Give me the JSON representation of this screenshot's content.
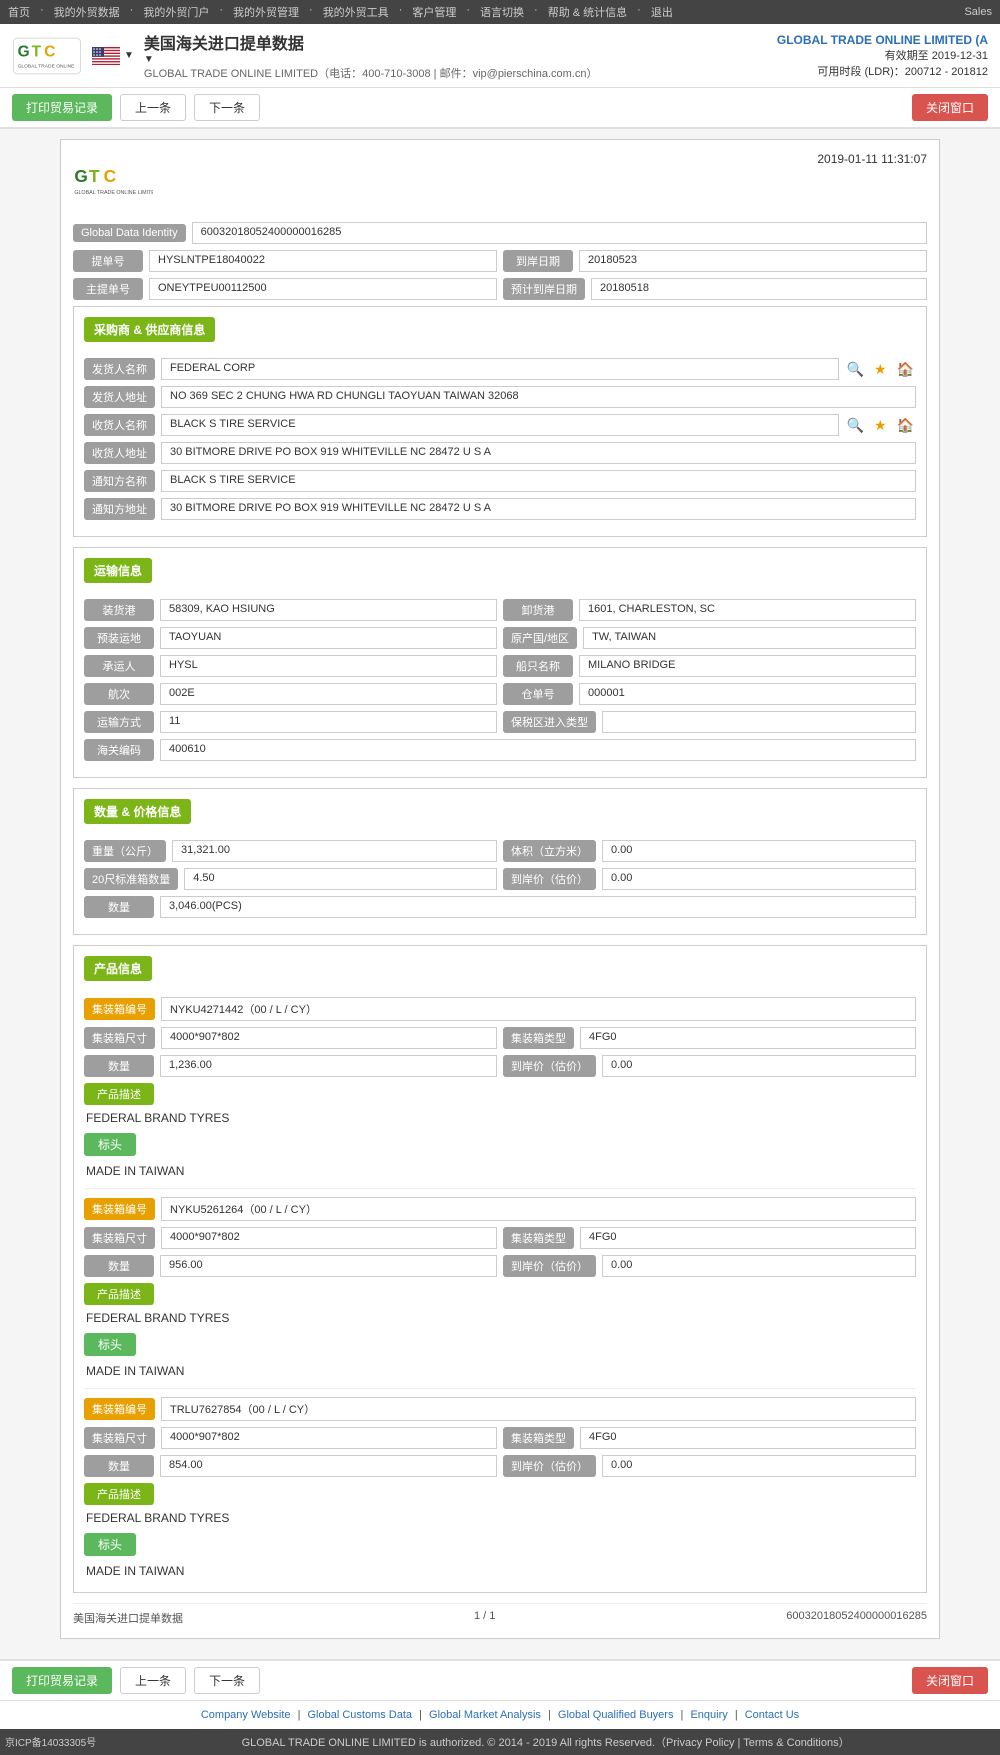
{
  "topnav": {
    "items": [
      "首页",
      "我的外贸数据",
      "我的外贸门户",
      "我的外贸管理",
      "我的外贸工具",
      "客户管理",
      "语言切换",
      "帮助 & 统计信息",
      "退出"
    ],
    "sales": "Sales"
  },
  "header": {
    "page_title": "美国海关进口提单数据",
    "subtitle": "GLOBAL TRADE ONLINE LIMITED（电话：400-710-3008 | 邮件：vip@pierschina.com.cn）",
    "brand": "GLOBAL TRADE ONLINE LIMITED (A",
    "valid_until": "有效期至 2019-12-31",
    "ldr": "可用时段 (LDR)：200712 - 201812"
  },
  "toolbar": {
    "print_label": "打印贸易记录",
    "prev_label": "上一条",
    "next_label": "下一条",
    "close_label": "关闭窗口"
  },
  "document": {
    "timestamp": "2019-01-11 11:31:07",
    "gdi_label": "Global Data Identity",
    "gdi_value": "60032018052400000016285",
    "fields": {
      "提单号_label": "提单号",
      "提单号_value": "HYSLNTPE18040022",
      "到岸日期_label": "到岸日期",
      "到岸日期_value": "20180523",
      "主提单号_label": "主提单号",
      "主提单号_value": "ONEYTPEU00112500",
      "预计到岸日期_label": "预计到岸日期",
      "预计到岸日期_value": "20180518"
    }
  },
  "buyer_supplier": {
    "section_title": "采购商 & 供应商信息",
    "rows": [
      {
        "label": "发货人名称",
        "value": "FEDERAL CORP",
        "has_icons": true
      },
      {
        "label": "发货人地址",
        "value": "NO 369 SEC 2 CHUNG HWA RD CHUNGLI TAOYUAN TAIWAN 32068",
        "has_icons": false
      },
      {
        "label": "收货人名称",
        "value": "BLACK S TIRE SERVICE",
        "has_icons": true
      },
      {
        "label": "收货人地址",
        "value": "30 BITMORE DRIVE PO BOX 919 WHITEVILLE NC 28472 U S A",
        "has_icons": false
      },
      {
        "label": "通知方名称",
        "value": "BLACK S TIRE SERVICE",
        "has_icons": false
      },
      {
        "label": "通知方地址",
        "value": "30 BITMORE DRIVE PO BOX 919 WHITEVILLE NC 28472 U S A",
        "has_icons": false
      }
    ]
  },
  "transport": {
    "section_title": "运输信息",
    "rows": [
      {
        "label1": "装货港",
        "value1": "58309, KAO HSIUNG",
        "label2": "卸货港",
        "value2": "1601, CHARLESTON, SC"
      },
      {
        "label1": "预装运地",
        "value1": "TAOYUAN",
        "label2": "原产国/地区",
        "value2": "TW, TAIWAN"
      },
      {
        "label1": "承运人",
        "value1": "HYSL",
        "label2": "船只名称",
        "value2": "MILANO BRIDGE"
      },
      {
        "label1": "航次",
        "value1": "002E",
        "label2": "仓单号",
        "value2": "000001"
      },
      {
        "label1": "运输方式",
        "value1": "11",
        "label2": "保税区进入类型",
        "value2": ""
      },
      {
        "label1": "海关编码",
        "value1": "400610",
        "label2": "",
        "value2": ""
      }
    ]
  },
  "quantity_price": {
    "section_title": "数量 & 价格信息",
    "rows": [
      {
        "label1": "重量（公斤）",
        "value1": "31,321.00",
        "label2": "体积（立方米）",
        "value2": "0.00"
      },
      {
        "label1": "20尺标准箱数量",
        "value1": "4.50",
        "label2": "到岸价（估价）",
        "value2": "0.00"
      },
      {
        "label1": "数量",
        "value1": "3,046.00(PCS)",
        "label2": "",
        "value2": ""
      }
    ]
  },
  "products": {
    "section_title": "产品信息",
    "items": [
      {
        "container_no_label": "集装箱编号",
        "container_no": "NYKU4271442（00 / L / CY）",
        "size_label": "集装箱尺寸",
        "size": "4000*907*802",
        "type_label": "集装箱类型",
        "type": "4FG0",
        "qty_label": "数量",
        "qty": "1,236.00",
        "price_label": "到岸价（估价）",
        "price": "0.00",
        "desc_label": "产品描述",
        "desc": "FEDERAL BRAND TYRES",
        "biaotou": "标头",
        "mark": "MADE IN TAIWAN"
      },
      {
        "container_no_label": "集装箱编号",
        "container_no": "NYKU5261264（00 / L / CY）",
        "size_label": "集装箱尺寸",
        "size": "4000*907*802",
        "type_label": "集装箱类型",
        "type": "4FG0",
        "qty_label": "数量",
        "qty": "956.00",
        "price_label": "到岸价（估价）",
        "price": "0.00",
        "desc_label": "产品描述",
        "desc": "FEDERAL BRAND TYRES",
        "biaotou": "标头",
        "mark": "MADE IN TAIWAN"
      },
      {
        "container_no_label": "集装箱编号",
        "container_no": "TRLU7627854（00 / L / CY）",
        "size_label": "集装箱尺寸",
        "size": "4000*907*802",
        "type_label": "集装箱类型",
        "type": "4FG0",
        "qty_label": "数量",
        "qty": "854.00",
        "price_label": "到岸价（估价）",
        "price": "0.00",
        "desc_label": "产品描述",
        "desc": "FEDERAL BRAND TYRES",
        "biaotou": "标头",
        "mark": "MADE IN TAIWAN"
      }
    ]
  },
  "doc_footer": {
    "title": "美国海关进口提单数据",
    "page": "1 / 1",
    "gdi": "60032018052400000016285"
  },
  "footer": {
    "icp": "京ICP备14033305号",
    "links": [
      "Company Website",
      "Global Customs Data",
      "Global Market Analysis",
      "Global Qualified Buyers",
      "Enquiry",
      "Contact Us"
    ],
    "copyright": "GLOBAL TRADE ONLINE LIMITED is authorized. © 2014 - 2019 All rights Reserved.（Privacy Policy | Terms & Conditions）"
  }
}
